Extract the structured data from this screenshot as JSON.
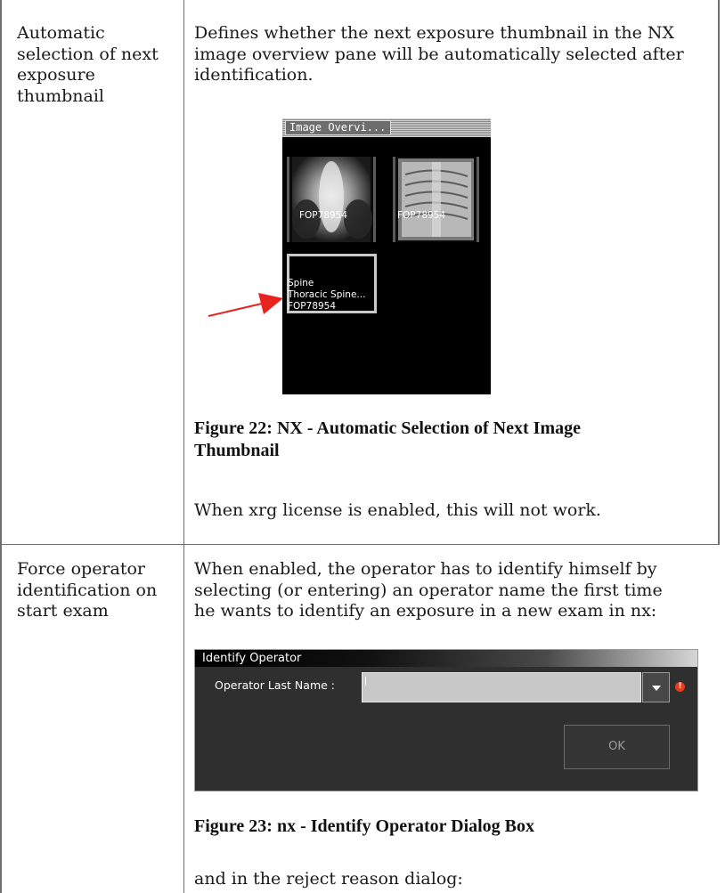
{
  "rows": [
    {
      "setting": [
        "Automatic",
        "selection of next",
        "exposure",
        "thumbnail"
      ],
      "description": [
        "Defines whether the next exposure thumbnail in the NX",
        "image overview pane will be automatically selected after",
        "identification."
      ],
      "figure": {
        "pane_title": "Image Overvi...",
        "thumbnails": [
          {
            "lines": [
              "FOP78954"
            ]
          },
          {
            "lines": [
              "FOP78954"
            ]
          },
          {
            "lines": [
              "Spine",
              "Thoracic Spine...",
              "FOP78954"
            ],
            "selected": true
          }
        ],
        "arrow_color": "#e8231f"
      },
      "caption": [
        "Figure 22: NX - Automatic Selection of Next Image",
        "Thumbnail"
      ],
      "note": "When xrg license is enabled, this will not work."
    },
    {
      "setting": [
        "Force operator",
        "identification on",
        "start exam"
      ],
      "description": [
        "When enabled, the operator has to identify himself by",
        "selecting (or entering) an operator name the first time",
        "he wants to identify an exposure in a new exam in nx:"
      ],
      "dialog": {
        "title": "Identify Operator",
        "field_label": "Operator Last Name :",
        "field_value": "",
        "ok_label": "OK",
        "warning_icon": "!"
      },
      "caption": [
        "Figure 23: nx - Identify Operator Dialog Box"
      ],
      "note": "and in the reject reason dialog:"
    }
  ]
}
